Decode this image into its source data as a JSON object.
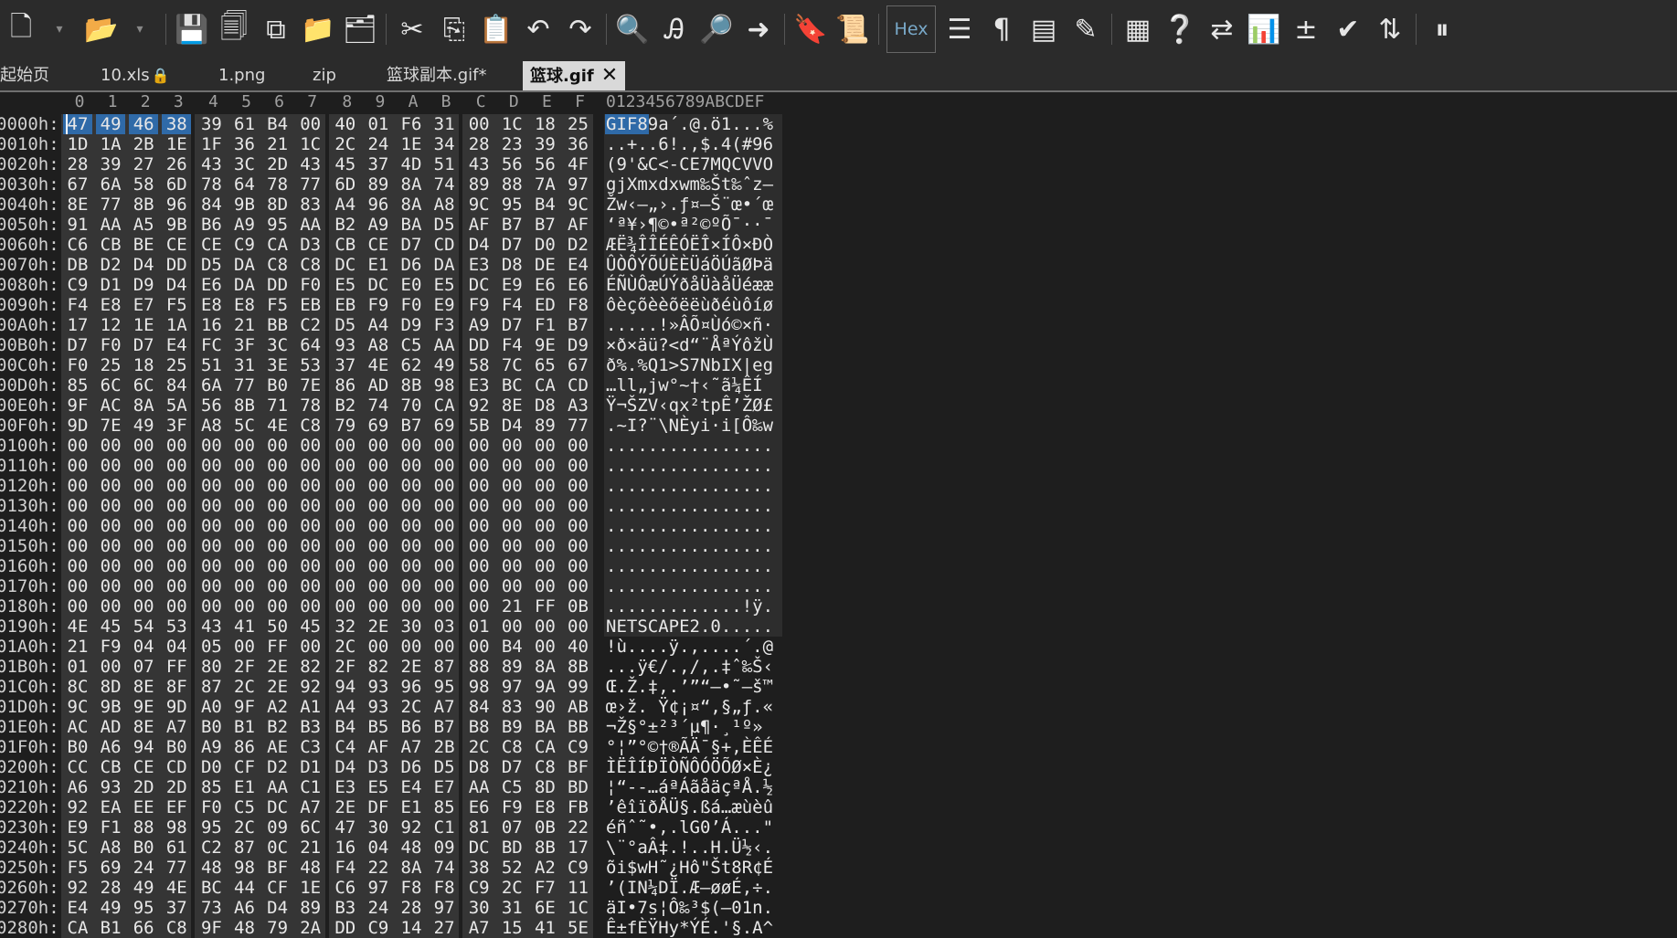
{
  "toolbar": {
    "hex_label": "Hex",
    "icons": [
      "new-file-icon",
      "open-folder-icon",
      "save-icon",
      "save-all-icon",
      "duplicate-icon",
      "folder-icon",
      "folders-icon",
      "cut-icon",
      "copy-icon",
      "paste-icon",
      "undo-icon",
      "redo-icon",
      "find-icon",
      "replace-icon",
      "find-in-files-icon",
      "goto-icon",
      "bookmark-icon",
      "scroll-icon",
      "hex-mode-icon",
      "column-icon",
      "pilcrow-icon",
      "list-icon",
      "highlight-icon",
      "calculator-icon",
      "help-icon",
      "swap-icon",
      "chart-icon",
      "plus-minus-icon",
      "checkmark-icon",
      "base-convert-icon",
      "pause-icon"
    ]
  },
  "tabs": [
    {
      "label": "起始页",
      "active": false
    },
    {
      "label": "10.xls",
      "active": false,
      "locked": true
    },
    {
      "label": "1.png",
      "active": false
    },
    {
      "label": "zip",
      "active": false
    },
    {
      "label": "篮球副本.gif*",
      "active": false
    },
    {
      "label": "篮球.gif",
      "active": true
    }
  ],
  "hex_view": {
    "column_headers": [
      "0",
      "1",
      "2",
      "3",
      "4",
      "5",
      "6",
      "7",
      "8",
      "9",
      "A",
      "B",
      "C",
      "D",
      "E",
      "F"
    ],
    "ascii_header": "0123456789ABCDEF",
    "rows": [
      {
        "offset": "0000h:",
        "bytes": "47 49 46 38 39 61 B4 00 40 01 F6 31 00 1C 18 25",
        "ascii": "GIF89a´.@.ö1...%"
      },
      {
        "offset": "0010h:",
        "bytes": "1D 1A 2B 1E 1F 36 21 1C 2C 24 1E 34 28 23 39 36",
        "ascii": "..+..6!.,$.4(#96"
      },
      {
        "offset": "0020h:",
        "bytes": "28 39 27 26 43 3C 2D 43 45 37 4D 51 43 56 56 4F",
        "ascii": "(9'&C<-CE7MQCVVO"
      },
      {
        "offset": "0030h:",
        "bytes": "67 6A 58 6D 78 64 78 77 6D 89 8A 74 89 88 7A 97",
        "ascii": "gjXmxdxwm‰Št‰ˆz—"
      },
      {
        "offset": "0040h:",
        "bytes": "8E 77 8B 96 84 9B 8D 83 A4 96 8A A8 9C 95 B4 9C",
        "ascii": "Žw‹–„›.ƒ¤–Š¨œ•´œ"
      },
      {
        "offset": "0050h:",
        "bytes": "91 AA A5 9B B6 A9 95 AA B2 A9 BA D5 AF B7 B7 AF",
        "ascii": "‘ª¥›¶©•ª²©ºÕ¯··¯"
      },
      {
        "offset": "0060h:",
        "bytes": "C6 CB BE CE CE C9 CA D3 CB CE D7 CD D4 D7 D0 D2",
        "ascii": "ÆË¾ÎÎÉÊÓËÎ×ÍÔ×ÐÒ"
      },
      {
        "offset": "0070h:",
        "bytes": "DB D2 D4 DD D5 DA C8 C8 DC E1 D6 DA E3 D8 DE E4",
        "ascii": "ÛÒÔÝÕÚÈÈÜáÖÚãØÞä"
      },
      {
        "offset": "0080h:",
        "bytes": "C9 D1 D9 D4 E6 DA DD F0 E5 DC E0 E5 DC E9 E6 E6",
        "ascii": "ÉÑÙÔæÚÝðåÜàåÜéææ"
      },
      {
        "offset": "0090h:",
        "bytes": "F4 E8 E7 F5 E8 E8 F5 EB EB F9 F0 E9 F9 F4 ED F8",
        "ascii": "ôèçõèèõëëùðéùôíø"
      },
      {
        "offset": "00A0h:",
        "bytes": "17 12 1E 1A 16 21 BB C2 D5 A4 D9 F3 A9 D7 F1 B7",
        "ascii": ".....!»ÂÕ¤Ùó©×ñ·"
      },
      {
        "offset": "00B0h:",
        "bytes": "D7 F0 D7 E4 FC 3F 3C 64 93 A8 C5 AA DD F4 9E D9",
        "ascii": "×ð×äü?<d“¨ÅªÝôžÙ"
      },
      {
        "offset": "00C0h:",
        "bytes": "F0 25 18 25 51 31 3E 53 37 4E 62 49 58 7C 65 67",
        "ascii": "ð%.%Q1>S7NbIX|eg"
      },
      {
        "offset": "00D0h:",
        "bytes": "85 6C 6C 84 6A 77 B0 7E 86 AD 8B 98 E3 BC CA CD",
        "ascii": "…ll„jw°~†­‹˜ã¼ÊÍ"
      },
      {
        "offset": "00E0h:",
        "bytes": "9F AC 8A 5A 56 8B 71 78 B2 74 70 CA 92 8E D8 A3",
        "ascii": "Ÿ¬ŠZV‹qx²tpÊ’ŽØ£"
      },
      {
        "offset": "00F0h:",
        "bytes": "9D 7E 49 3F A8 5C 4E C8 79 69 B7 69 5B D4 89 77",
        "ascii": ".~I?¨\\NÈyi·i[Ô‰w"
      },
      {
        "offset": "0100h:",
        "bytes": "00 00 00 00 00 00 00 00 00 00 00 00 00 00 00 00",
        "ascii": "................"
      },
      {
        "offset": "0110h:",
        "bytes": "00 00 00 00 00 00 00 00 00 00 00 00 00 00 00 00",
        "ascii": "................"
      },
      {
        "offset": "0120h:",
        "bytes": "00 00 00 00 00 00 00 00 00 00 00 00 00 00 00 00",
        "ascii": "................"
      },
      {
        "offset": "0130h:",
        "bytes": "00 00 00 00 00 00 00 00 00 00 00 00 00 00 00 00",
        "ascii": "................"
      },
      {
        "offset": "0140h:",
        "bytes": "00 00 00 00 00 00 00 00 00 00 00 00 00 00 00 00",
        "ascii": "................"
      },
      {
        "offset": "0150h:",
        "bytes": "00 00 00 00 00 00 00 00 00 00 00 00 00 00 00 00",
        "ascii": "................"
      },
      {
        "offset": "0160h:",
        "bytes": "00 00 00 00 00 00 00 00 00 00 00 00 00 00 00 00",
        "ascii": "................"
      },
      {
        "offset": "0170h:",
        "bytes": "00 00 00 00 00 00 00 00 00 00 00 00 00 00 00 00",
        "ascii": "................"
      },
      {
        "offset": "0180h:",
        "bytes": "00 00 00 00 00 00 00 00 00 00 00 00 00 21 FF 0B",
        "ascii": ".............!ÿ."
      },
      {
        "offset": "0190h:",
        "bytes": "4E 45 54 53 43 41 50 45 32 2E 30 03 01 00 00 00",
        "ascii": "NETSCAPE2.0....."
      },
      {
        "offset": "01A0h:",
        "bytes": "21 F9 04 04 05 00 FF 00 2C 00 00 00 00 B4 00 40",
        "ascii": "!ù....ÿ.,....´.@"
      },
      {
        "offset": "01B0h:",
        "bytes": "01 00 07 FF 80 2F 2E 82 2F 82 2E 87 88 89 8A 8B",
        "ascii": "...ÿ€/.‚/‚.‡ˆ‰Š‹"
      },
      {
        "offset": "01C0h:",
        "bytes": "8C 8D 8E 8F 87 2C 2E 92 94 93 96 95 98 97 9A 99",
        "ascii": "Œ.Ž.‡,.’”“–•˜—š™"
      },
      {
        "offset": "01D0h:",
        "bytes": "9C 9B 9E 9D A0 9F A2 A1 A4 93 2C A7 84 83 90 AB",
        "ascii": "œ›ž. Ÿ¢¡¤“,§„ƒ.«"
      },
      {
        "offset": "01E0h:",
        "bytes": "AC AD 8E A7 B0 B1 B2 B3 B4 B5 B6 B7 B8 B9 BA BB",
        "ascii": "¬­Ž§°±²³´µ¶·¸¹º»"
      },
      {
        "offset": "01F0h:",
        "bytes": "B0 A6 94 B0 A9 86 AE C3 C4 AF A7 2B 2C C8 CA C9",
        "ascii": "°¦”°©†®ÃÄ¯§+,ÈÊÉ"
      },
      {
        "offset": "0200h:",
        "bytes": "CC CB CE CD D0 CF D2 D1 D4 D3 D6 D5 D8 D7 C8 BF",
        "ascii": "ÌËÎÍÐÏÒÑÔÓÖÕØ×È¿"
      },
      {
        "offset": "0210h:",
        "bytes": "A6 93 2D 2D 85 E1 AA C1 E3 E5 E4 E7 AA C5 8D BD",
        "ascii": "¦“--…áªÁãåäçªÅ.½"
      },
      {
        "offset": "0220h:",
        "bytes": "92 EA EE EF F0 C5 DC A7 2E DF E1 85 E6 F9 E8 FB",
        "ascii": "’êîïðÅÜ§.ßá…æùèû"
      },
      {
        "offset": "0230h:",
        "bytes": "E9 F1 88 98 95 2C 09 6C 47 30 92 C1 81 07 0B 22",
        "ascii": "éñˆ˜•,.lG0’Á...\""
      },
      {
        "offset": "0240h:",
        "bytes": "5C A8 B0 61 C2 87 0C 21 16 04 48 09 DC BD 8B 17",
        "ascii": "\\¨°aÂ‡.!..H.Ü½‹."
      },
      {
        "offset": "0250h:",
        "bytes": "F5 69 24 77 48 98 BF 48 F4 22 8A 74 38 52 A2 C9",
        "ascii": "õi$wH˜¿Hô\"Št8R¢É"
      },
      {
        "offset": "0260h:",
        "bytes": "92 28 49 4E BC 44 CF 1E C6 97 F8 F8 C9 2C F7 11",
        "ascii": "’(IN¼DÏ.Æ—øøÉ,÷."
      },
      {
        "offset": "0270h:",
        "bytes": "E4 49 95 37 73 A6 D4 89 B3 24 28 97 30 31 6E 1C",
        "ascii": "äI•7s¦Ô‰³$(—01n."
      },
      {
        "offset": "0280h:",
        "bytes": "CA B1 66 C8 9F 48 79 2A DD C9 14 27 A7 15 41 5E",
        "ascii": "Ê±fÈŸHy*ÝÉ.'§.A^"
      }
    ]
  }
}
